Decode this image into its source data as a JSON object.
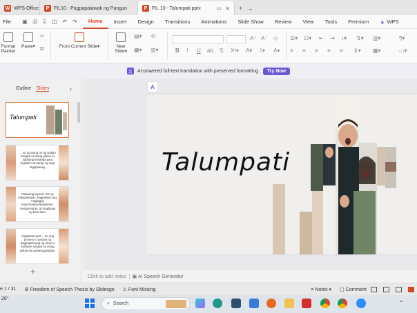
{
  "tabs": [
    {
      "label": "WPS Office",
      "icon": "wps-icon",
      "color": "#d24726"
    },
    {
      "label": "FIL10 - Pagpapalawak ng Pangun",
      "icon": "presentation-icon",
      "color": "#d24726"
    },
    {
      "label": "FIL 10 - Talumpati.pptx",
      "icon": "presentation-icon",
      "color": "#d24726",
      "active": true
    }
  ],
  "menu": {
    "file": "File",
    "items": [
      "Home",
      "Insert",
      "Design",
      "Transitions",
      "Animations",
      "Slide Show",
      "Review",
      "View",
      "Tools",
      "Premium"
    ],
    "active": "Home",
    "wps": "WPS"
  },
  "ribbon": {
    "format_painter_1": "Format",
    "format_painter_2": "Painter",
    "paste": "Paste",
    "from_current_slide": "From Current Slide",
    "new_slide_1": "New",
    "new_slide_2": "Slide"
  },
  "ai_banner": {
    "text": "AI-powered full-text translation with preserved formatting.",
    "button": "Try Now"
  },
  "panel": {
    "outline_tab": "Outline",
    "slides_tab": "Slides",
    "add_slide": "+"
  },
  "thumbnails": [
    {
      "text": "Talumpati"
    },
    {
      "text": "... Ito ay isang uri ng sulatin tungkol sa isang paksa at sadyang inihanda para bigkasin sa harap ng mga tagapakinig."
    },
    {
      "text": "Maaaring layunin nito ay manghikayat, magpaliwa nag, magbigay impormasyon/kaalaman, mangat wiran, at magbigay ng kuro-kuro."
    },
    {
      "text": "Pagtatalumpati -- Ito ang proseso o paraan ng pagpapahayag ng ideya o kaisipan tungkol sa isang paksa sa paraang pasalita."
    }
  ],
  "slide": {
    "title": "Talumpati",
    "background": "#f0efed"
  },
  "notes": {
    "placeholder": "Click to add notes",
    "speech_generator": "AI Speech Generator"
  },
  "status": {
    "slide_counter": "e 1 / 31",
    "theme": "Freedom of Speech Thesis by Slidesgo",
    "font_missing": "Font Missing",
    "notes": "Notes",
    "comment": "Comment"
  },
  "taskbar": {
    "weather": "26°",
    "search_placeholder": "Search"
  },
  "colors": {
    "accent": "#d24726",
    "ai_purple": "#6b57d6"
  }
}
